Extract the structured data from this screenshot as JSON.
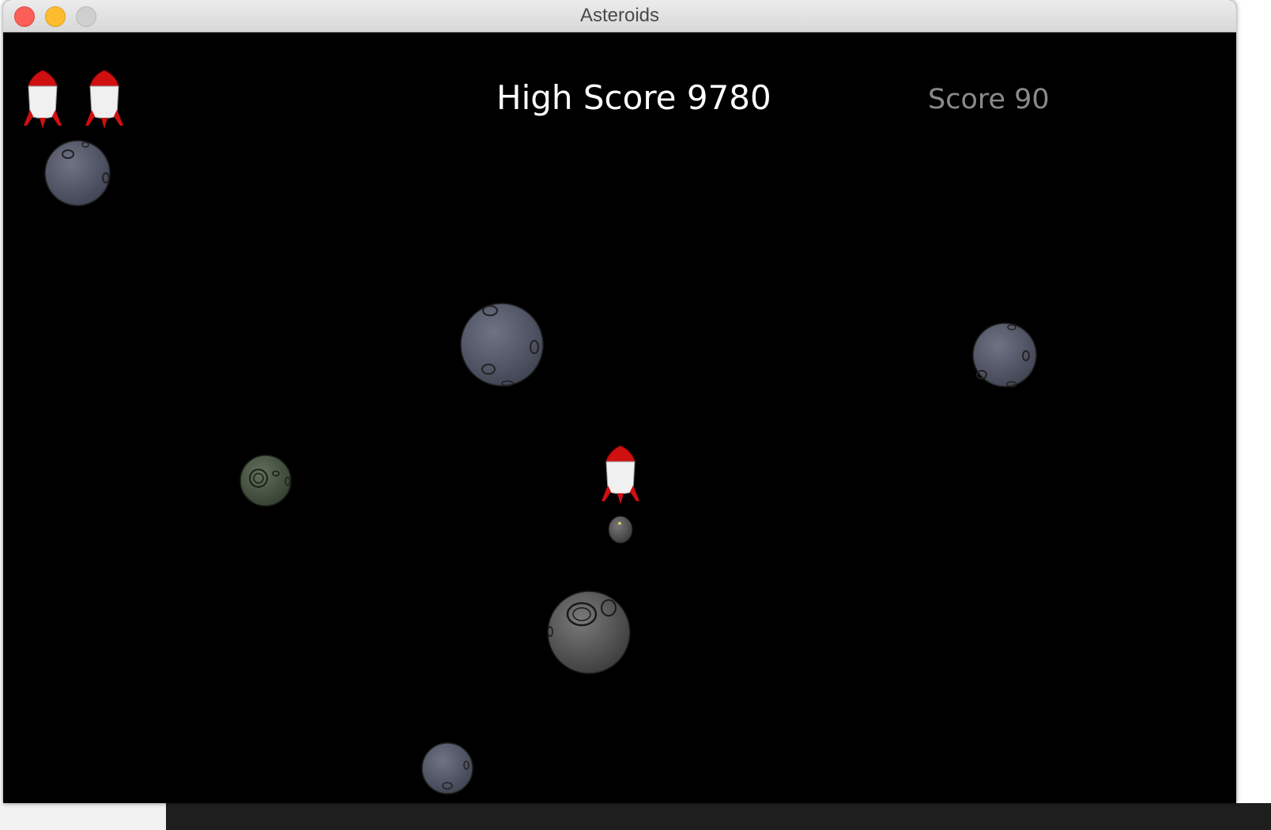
{
  "window": {
    "title": "Asteroids"
  },
  "hud": {
    "high_score_label": "High Score 9780",
    "score_label": "Score 90",
    "lives_remaining": 2
  },
  "colors": {
    "background": "#000000",
    "high_score_text": "#ffffff",
    "score_text": "#8a8a8a",
    "ship_body": "#f0f0f0",
    "ship_nose": "#d01010",
    "asteroid_gray": "#55596a",
    "asteroid_green": "#4b5a45"
  },
  "icons": {
    "life": "rocket-icon",
    "player": "rocket-icon",
    "asteroid": "asteroid-icon"
  }
}
